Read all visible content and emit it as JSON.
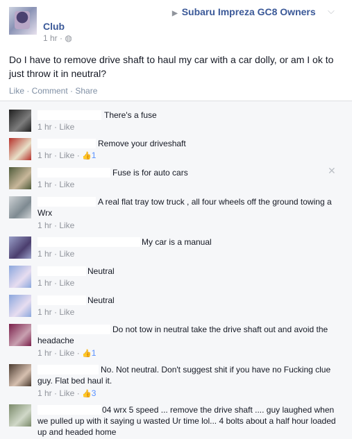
{
  "post": {
    "poster_name": "Club",
    "timestamp": "1 hr",
    "privacy_icon": "globe-icon",
    "group_name": "Subaru Impreza GC8 Owners",
    "text": "Do I have to remove drive shaft to haul my car with a car dolly, or am I ok to just throw it in neutral?",
    "actions": "Like · Comment · Share"
  },
  "comments": [
    {
      "text": "There's a fuse",
      "meta": "1 hr · Like",
      "likes": ""
    },
    {
      "text": "Remove your driveshaft",
      "meta": "1 hr · Like · ",
      "likes": "1"
    },
    {
      "text": "Fuse is for auto cars",
      "meta": "1 hr · Like",
      "likes": ""
    },
    {
      "text": "A real flat tray tow truck , all four wheels off the ground towing a Wrx",
      "meta": "1 hr · Like",
      "likes": ""
    },
    {
      "text": "My car is a manual",
      "meta": "1 hr · Like",
      "likes": ""
    },
    {
      "text": "Neutral",
      "meta": "1 hr · Like",
      "likes": ""
    },
    {
      "text": "Neutral",
      "meta": "1 hr · Like",
      "likes": ""
    },
    {
      "text": "Do not tow in neutral take the drive shaft out and avoid the headache",
      "meta": "1 hr · Like · ",
      "likes": "1"
    },
    {
      "text": "No. Not neutral. Don't suggest shit if you have no Fucking clue guy. Flat bed haul it.",
      "meta": "1 hr · Like · ",
      "likes": "3"
    },
    {
      "text": "04 wrx 5 speed ... remove the drive shaft .... guy laughed when we pulled up with it saying u wasted Ur time lol... 4 bolts about a half hour loaded up and headed home",
      "meta": "",
      "likes": ""
    }
  ],
  "colors": {
    "link": "#3b5998",
    "meta": "#90949c",
    "like_blue": "#5890ff",
    "bg": "#e9ebee"
  }
}
